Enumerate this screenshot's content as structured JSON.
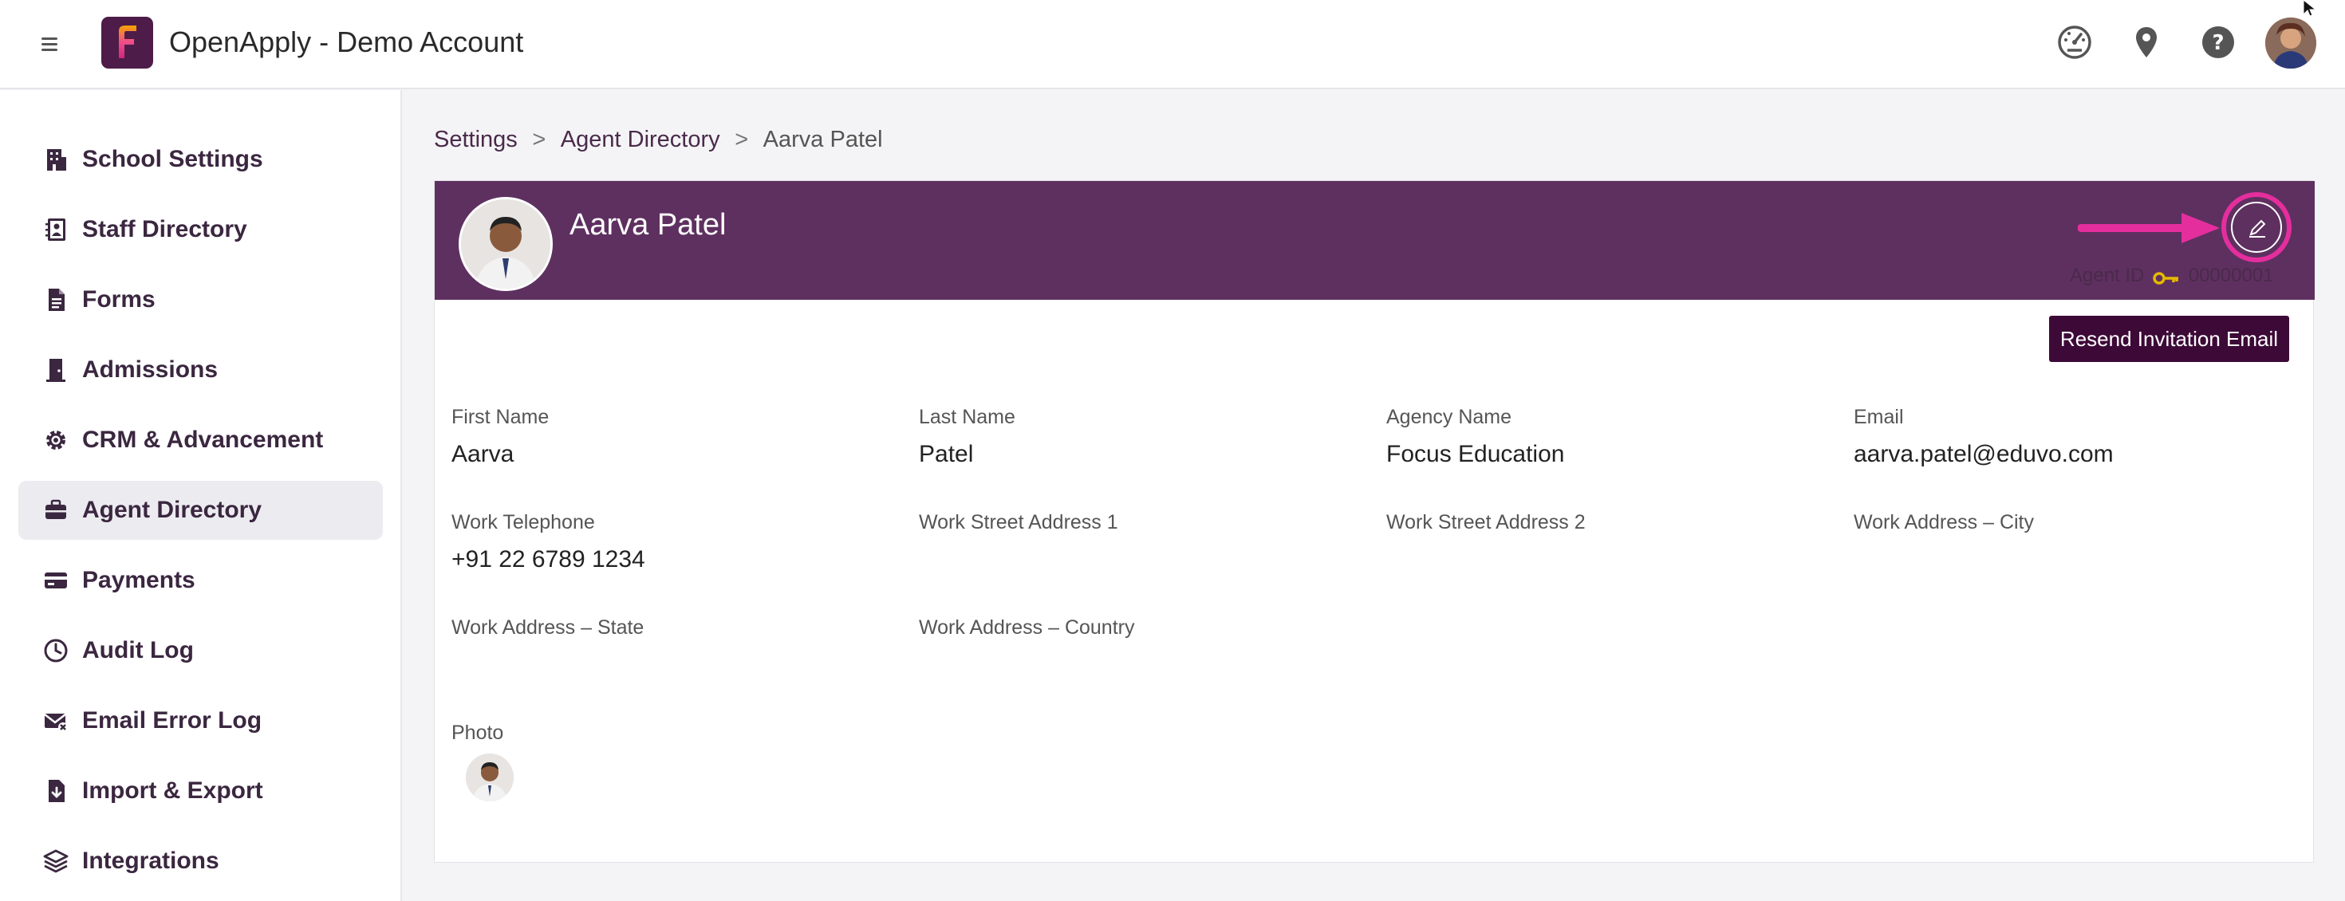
{
  "header": {
    "app_title": "OpenApply - Demo Account",
    "icons": [
      "menu-icon",
      "dashboard-gauge-icon",
      "location-pin-icon",
      "help-icon",
      "user-avatar"
    ]
  },
  "sidebar": {
    "items": [
      {
        "label": "School Settings",
        "icon": "building-icon",
        "active": false
      },
      {
        "label": "Staff Directory",
        "icon": "address-book-icon",
        "active": false
      },
      {
        "label": "Forms",
        "icon": "document-icon",
        "active": false
      },
      {
        "label": "Admissions",
        "icon": "door-icon",
        "active": false
      },
      {
        "label": "CRM & Advancement",
        "icon": "gear-icon",
        "active": false
      },
      {
        "label": "Agent Directory",
        "icon": "briefcase-icon",
        "active": true
      },
      {
        "label": "Payments",
        "icon": "credit-card-icon",
        "active": false
      },
      {
        "label": "Audit Log",
        "icon": "clock-icon",
        "active": false
      },
      {
        "label": "Email Error Log",
        "icon": "email-error-icon",
        "active": false
      },
      {
        "label": "Import & Export",
        "icon": "file-import-icon",
        "active": false
      },
      {
        "label": "Integrations",
        "icon": "layers-icon",
        "active": false
      }
    ]
  },
  "breadcrumb": {
    "items": [
      "Settings",
      "Agent Directory",
      "Aarva Patel"
    ],
    "separator": ">"
  },
  "agent": {
    "name": "Aarva Patel",
    "agent_id_label": "Agent ID",
    "agent_id": "00000001",
    "resend_button": "Resend Invitation Email",
    "fields": {
      "first_name": {
        "label": "First Name",
        "value": "Aarva"
      },
      "last_name": {
        "label": "Last Name",
        "value": "Patel"
      },
      "agency_name": {
        "label": "Agency Name",
        "value": "Focus Education"
      },
      "email": {
        "label": "Email",
        "value": "aarva.patel@eduvo.com"
      },
      "work_telephone": {
        "label": "Work Telephone",
        "value": "+91 22 6789 1234"
      },
      "work_street_1": {
        "label": "Work Street Address 1",
        "value": ""
      },
      "work_street_2": {
        "label": "Work Street Address 2",
        "value": ""
      },
      "work_city": {
        "label": "Work Address – City",
        "value": ""
      },
      "work_state": {
        "label": "Work Address – State",
        "value": ""
      },
      "work_country": {
        "label": "Work Address – Country",
        "value": ""
      },
      "photo": {
        "label": "Photo"
      }
    }
  },
  "colors": {
    "header_purple": "#5e3060",
    "button_dark": "#3d0a38",
    "highlight_pink": "#e52e9d"
  }
}
